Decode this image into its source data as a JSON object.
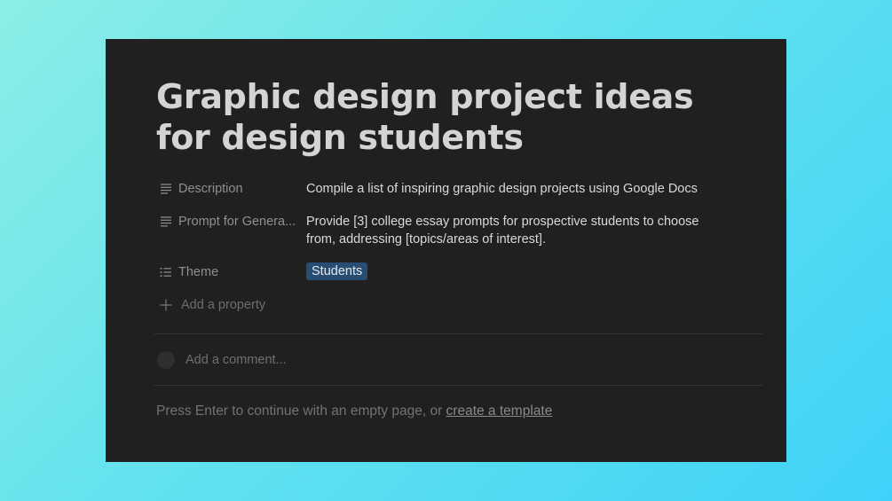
{
  "page": {
    "title": "Graphic design project ideas for design students"
  },
  "properties": [
    {
      "icon": "text-lines-icon",
      "name": "Description",
      "value": "Compile a list of inspiring graphic design projects using Google Docs"
    },
    {
      "icon": "text-lines-icon",
      "name": "Prompt for Genera...",
      "value": "Provide [3] college essay prompts for prospective students to choose from, addressing [topics/areas of interest]."
    },
    {
      "icon": "list-icon",
      "name": "Theme",
      "value": "Students",
      "tag_color": "#284d73"
    }
  ],
  "add_property": {
    "label": "Add a property",
    "icon": "plus-icon"
  },
  "comment": {
    "placeholder": "Add a comment..."
  },
  "footer": {
    "text": "Press Enter to continue with an empty page, or ",
    "link": "create a template"
  },
  "colors": {
    "panel_background": "#202020",
    "tag_background": "#284d73"
  }
}
